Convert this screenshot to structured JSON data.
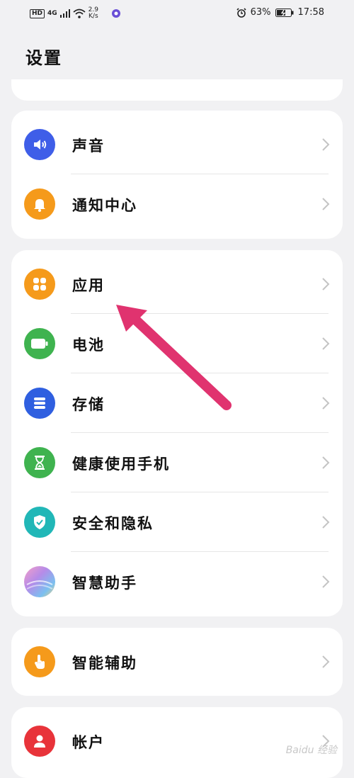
{
  "status_bar": {
    "net_badge": "HD",
    "net_type": "4G",
    "speed_value": "2.9",
    "speed_unit": "K/s",
    "battery": "63%",
    "time": "17:58"
  },
  "page": {
    "title": "设置"
  },
  "groups": [
    {
      "items": [
        {
          "label": "声音",
          "icon": "speaker-icon",
          "color": "#3f5ee8"
        },
        {
          "label": "通知中心",
          "icon": "bell-icon",
          "color": "#f59a1b"
        }
      ]
    },
    {
      "items": [
        {
          "label": "应用",
          "icon": "apps-icon",
          "color": "#f59a1b"
        },
        {
          "label": "电池",
          "icon": "battery-icon",
          "color": "#3fb34f"
        },
        {
          "label": "存储",
          "icon": "storage-icon",
          "color": "#2f5fe0"
        },
        {
          "label": "健康使用手机",
          "icon": "hourglass-icon",
          "color": "#3fb34f"
        },
        {
          "label": "安全和隐私",
          "icon": "shield-icon",
          "color": "#21b7b7"
        },
        {
          "label": "智慧助手",
          "icon": "assistant-icon",
          "color": "#b58be8"
        }
      ]
    },
    {
      "items": [
        {
          "label": "智能辅助",
          "icon": "hand-icon",
          "color": "#f59a1b"
        }
      ]
    },
    {
      "items": [
        {
          "label": "帐户",
          "icon": "user-icon",
          "color": "#e8333a"
        }
      ]
    }
  ],
  "annotation": {
    "color": "#e0336f"
  },
  "watermark": "Baidu 经验"
}
